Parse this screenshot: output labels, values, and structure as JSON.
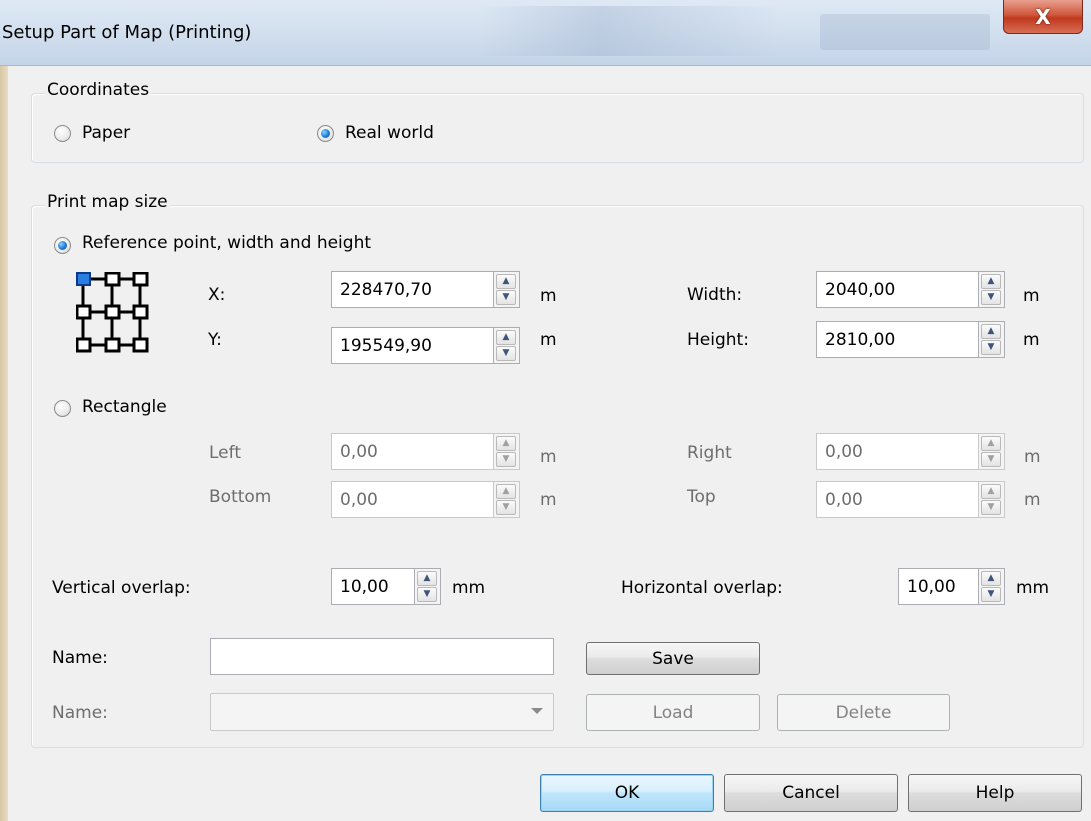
{
  "window": {
    "title": "Setup Part of Map (Printing)",
    "close_label": "X"
  },
  "coordinates": {
    "legend": "Coordinates",
    "options": [
      {
        "label": "Paper",
        "checked": false
      },
      {
        "label": "Real world",
        "checked": true
      }
    ]
  },
  "print_map_size": {
    "legend": "Print map size",
    "reference": {
      "label": "Reference point, width and height",
      "checked": true,
      "fields": {
        "x_label": "X:",
        "x_value": "228470,70",
        "y_label": "Y:",
        "y_value": "195549,90",
        "width_label": "Width:",
        "width_value": "2040,00",
        "height_label": "Height:",
        "height_value": "2810,00",
        "unit": "m"
      }
    },
    "rectangle": {
      "label": "Rectangle",
      "checked": false,
      "fields": {
        "left_label": "Left",
        "left_value": "0,00",
        "bottom_label": "Bottom",
        "bottom_value": "0,00",
        "right_label": "Right",
        "right_value": "0,00",
        "top_label": "Top",
        "top_value": "0,00",
        "unit": "m"
      }
    },
    "overlap": {
      "vertical_label": "Vertical overlap:",
      "vertical_value": "10,00",
      "horizontal_label": "Horizontal overlap:",
      "horizontal_value": "10,00",
      "unit": "mm"
    },
    "name": {
      "label": "Name:",
      "value": "",
      "save_label": "Save",
      "load_name_label": "Name:",
      "load_value": "",
      "load_label": "Load",
      "delete_label": "Delete"
    }
  },
  "footer": {
    "ok_label": "OK",
    "cancel_label": "Cancel",
    "help_label": "Help"
  },
  "colors": {
    "accent": "#1f7ad4",
    "close": "#c0391e",
    "selected_point": "#2a7de1"
  },
  "icons": {
    "spin_up": "▲",
    "spin_down": "▼"
  }
}
